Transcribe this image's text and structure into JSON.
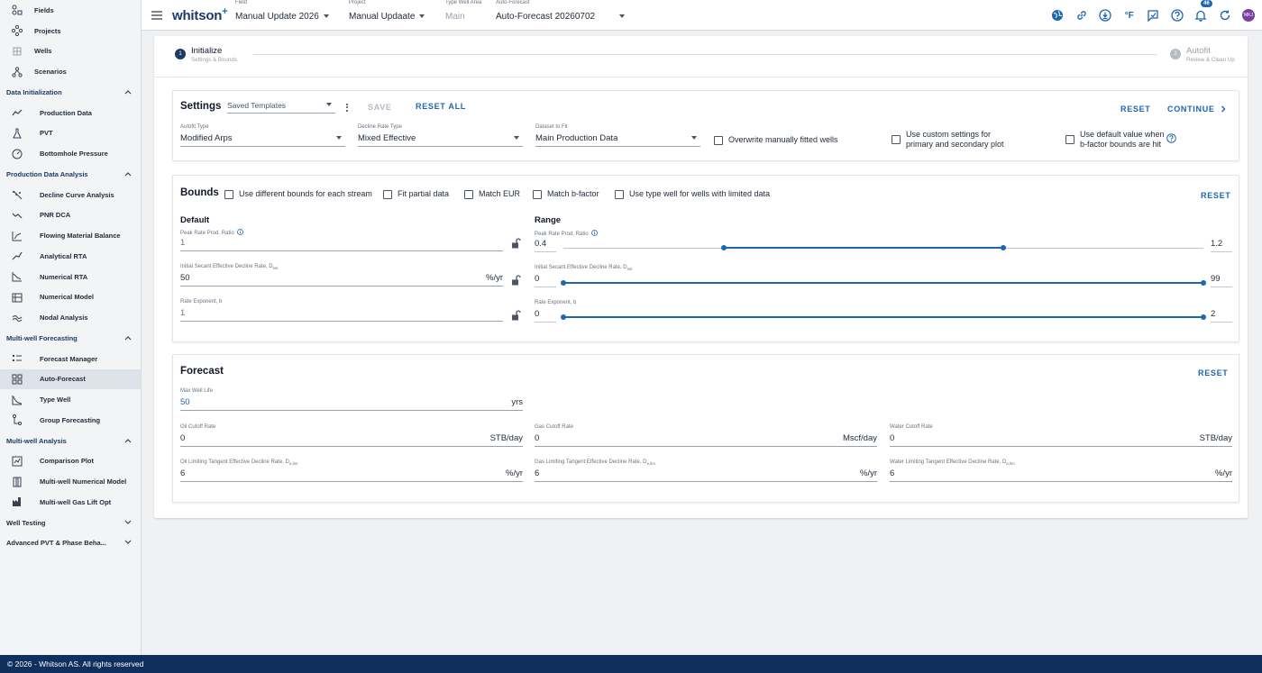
{
  "sidebar": {
    "top_items": [
      {
        "label": "Fields",
        "icon": "fields-icon"
      },
      {
        "label": "Projects",
        "icon": "projects-icon"
      },
      {
        "label": "Wells",
        "icon": "wells-icon"
      },
      {
        "label": "Scenarios",
        "icon": "scenarios-icon"
      }
    ],
    "sections": [
      {
        "label": "Data Initialization",
        "items": [
          "Production Data",
          "PVT",
          "Bottomhole Pressure"
        ]
      },
      {
        "label": "Production Data Analysis",
        "items": [
          "Decline Curve Analysis",
          "PNR DCA",
          "Flowing Material Balance",
          "Analytical RTA",
          "Numerical RTA",
          "Numerical Model",
          "Nodal Analysis"
        ]
      },
      {
        "label": "Multi-well Forecasting",
        "items": [
          "Forecast Manager",
          "Auto-Forecast",
          "Type Well",
          "Group Forecasting"
        ]
      },
      {
        "label": "Multi-well Analysis",
        "items": [
          "Comparison Plot",
          "Multi-well Numerical Model",
          "Multi-well Gas Lift Opt"
        ]
      }
    ],
    "collapsed_sections": [
      "Well Testing",
      "Advanced PVT & Phase Beha..."
    ]
  },
  "topbar": {
    "logo": "whitson",
    "logo_sup": "+",
    "field": {
      "caption": "Field",
      "value": "Manual Update 2026"
    },
    "project": {
      "caption": "Project",
      "value": "Manual Updaate"
    },
    "type_well_area": {
      "caption": "Type Well Area",
      "value": "Main"
    },
    "auto_forecast": {
      "caption": "Auto-Forecast",
      "value": "Auto-Forecast 20260702"
    },
    "unit_label": "°F",
    "notification_count": "46",
    "avatar_initials": "MKJ"
  },
  "stepper": {
    "step1": {
      "num": "1",
      "title": "Initialize",
      "sub": "Settings & Bounds"
    },
    "step2": {
      "num": "2",
      "title": "Autofit",
      "sub": "Review & Clean Up"
    }
  },
  "settings": {
    "title": "Settings",
    "template_value": "Saved Templates",
    "save": "SAVE",
    "reset_all": "RESET ALL",
    "reset": "RESET",
    "continue": "CONTINUE",
    "autofit_type": {
      "caption": "Autofit Type",
      "value": "Modified Arps"
    },
    "decline_rate_type": {
      "caption": "Decline Rate Type",
      "value": "Mixed Effective"
    },
    "dataset": {
      "caption": "Dataset to Fit",
      "value": "Main Production Data"
    },
    "cb_overwrite": "Overwrite manually fitted wells",
    "cb_custom_1": "Use custom settings for",
    "cb_custom_2": "primary and secondary plot",
    "cb_default_1": "Use default value when",
    "cb_default_2": "b-factor bounds are hit"
  },
  "bounds": {
    "title": "Bounds",
    "cb_diff": "Use different bounds for each stream",
    "cb_partial": "Fit partial data",
    "cb_eur": "Match EUR",
    "cb_bfactor": "Match b-factor",
    "cb_typewell": "Use type well for wells with limited data",
    "reset": "RESET",
    "default_h": "Default",
    "range_h": "Range",
    "peak": {
      "caption": "Peak Rate Prod. Ratio",
      "value": "1"
    },
    "secant": {
      "caption": "Initial Secant Effective Decline Rate, D",
      "sub": "sei",
      "value": "50",
      "unit": "%/yr"
    },
    "rate_exp": {
      "caption": "Rate Exponent, b",
      "value": "1"
    },
    "range_peak": {
      "caption": "Peak Rate Prod. Ratio",
      "min": "0.4",
      "max": "1.2",
      "low": 0.6,
      "high": 0.95
    },
    "range_secant": {
      "caption": "Initial Secant Effective Decline Rate, D",
      "sub": "sei",
      "min": "0",
      "max": "99",
      "low": 0,
      "high": 99
    },
    "range_rate": {
      "caption": "Rate Exponent, b",
      "min": "0",
      "max": "2",
      "low": 0,
      "high": 2
    }
  },
  "forecast": {
    "title": "Forecast",
    "reset": "RESET",
    "max_life": {
      "caption": "Max Well Life",
      "value": "50",
      "unit": "yrs"
    },
    "oil_cutoff": {
      "caption": "Oil Cutoff Rate",
      "value": "0",
      "unit": "STB/day"
    },
    "gas_cutoff": {
      "caption": "Gas Cutoff Rate",
      "value": "0",
      "unit": "Mscf/day"
    },
    "water_cutoff": {
      "caption": "Water Cutoff Rate",
      "value": "0",
      "unit": "STB/day"
    },
    "oil_lim": {
      "caption": "Oil Limiting Tangent Effective Decline Rate, D",
      "sub": "e,lim",
      "value": "6",
      "unit": "%/yr"
    },
    "gas_lim": {
      "caption": "Gas Limiting Tangent Effective Decline Rate, D",
      "sub": "e,lim",
      "value": "6",
      "unit": "%/yr"
    },
    "water_lim": {
      "caption": "Water Limiting Tangent Effective Decline Rate, D",
      "sub": "e,lim",
      "value": "6",
      "unit": "%/yr"
    }
  },
  "footer": "© 2026 - Whitson AS. All rights reserved"
}
